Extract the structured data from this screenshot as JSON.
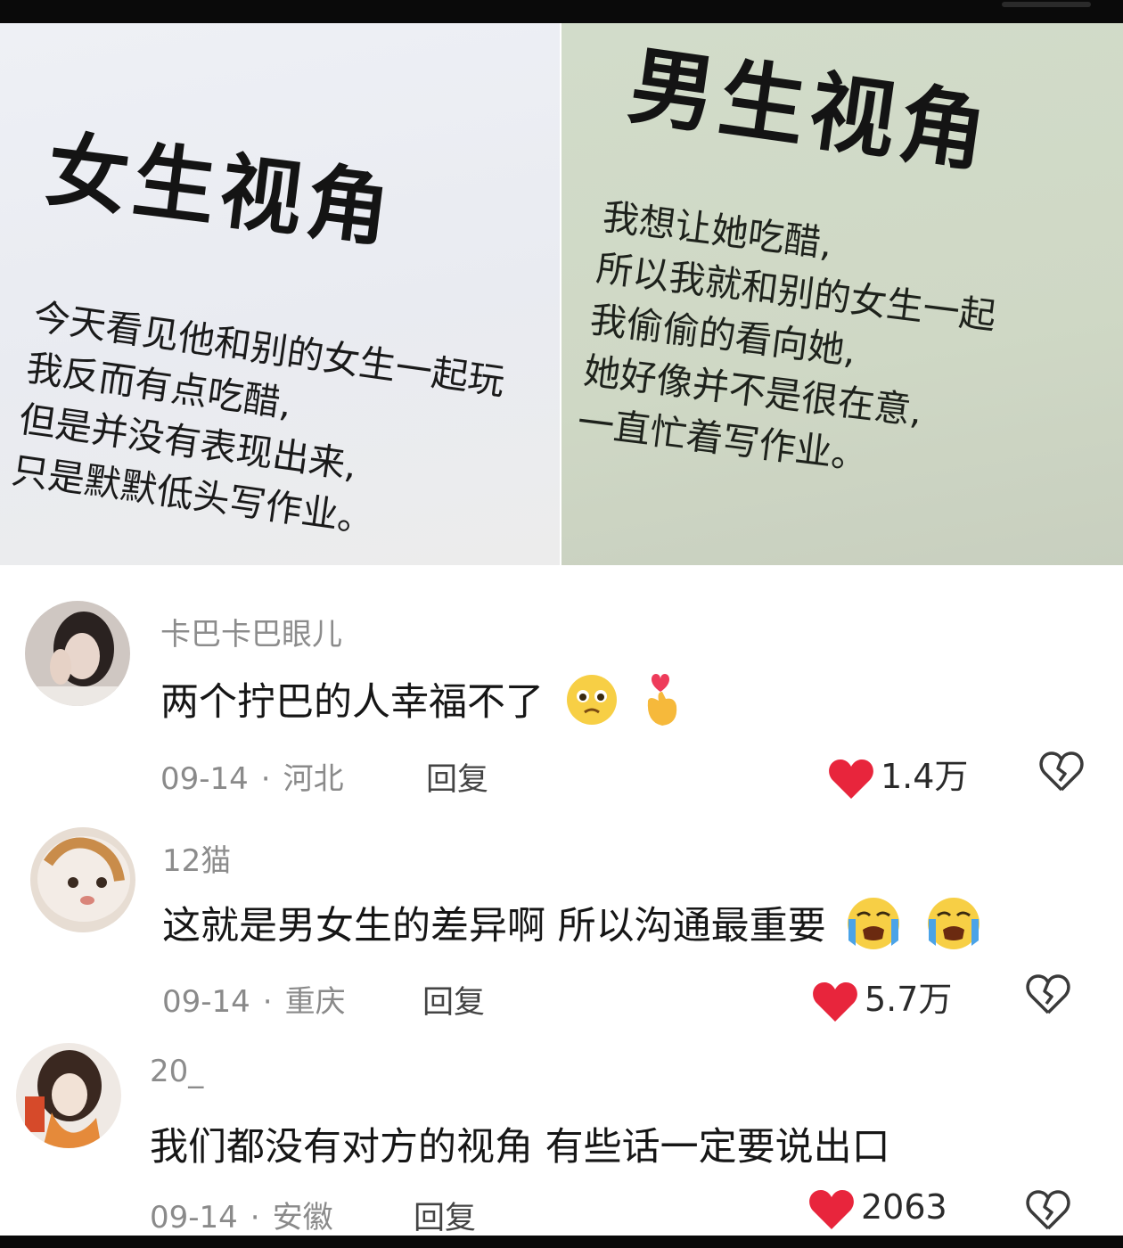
{
  "panels": {
    "left": {
      "heading": "女生视角",
      "lines": [
        "今天看见他和别的女生一起玩",
        "我反而有点吃醋,",
        "但是并没有表现出来,",
        "只是默默低头写作业。"
      ]
    },
    "right": {
      "heading": "男生视角",
      "lines": [
        "我想让她吃醋,",
        "所以我就和别的女生一起",
        "我偷偷的看向她,",
        "她好像并不是很在意,",
        "一直忙着写作业。"
      ]
    }
  },
  "comments": [
    {
      "user": "卡巴卡巴眼儿",
      "text": "两个拧巴的人幸福不了",
      "emojis": [
        "pleading-face-emoji",
        "finger-heart-emoji"
      ],
      "date": "09-14",
      "location": "河北",
      "reply": "回复",
      "likes": "1.4万"
    },
    {
      "user": "12猫",
      "text": "这就是男女生的差异啊 所以沟通最重要",
      "emojis": [
        "loudly-crying-face-emoji",
        "loudly-crying-face-emoji"
      ],
      "date": "09-14",
      "location": "重庆",
      "reply": "回复",
      "likes": "5.7万"
    },
    {
      "user": "20_",
      "text": "我们都没有对方的视角 有些话一定要说出口",
      "emojis": [],
      "date": "09-14",
      "location": "安徽",
      "reply": "回复",
      "likes": "2063"
    }
  ],
  "icons": {
    "like": "heart-icon",
    "dislike": "broken-heart-icon"
  },
  "colors": {
    "like": "#e8253c",
    "muted": "#8a8a8a"
  }
}
